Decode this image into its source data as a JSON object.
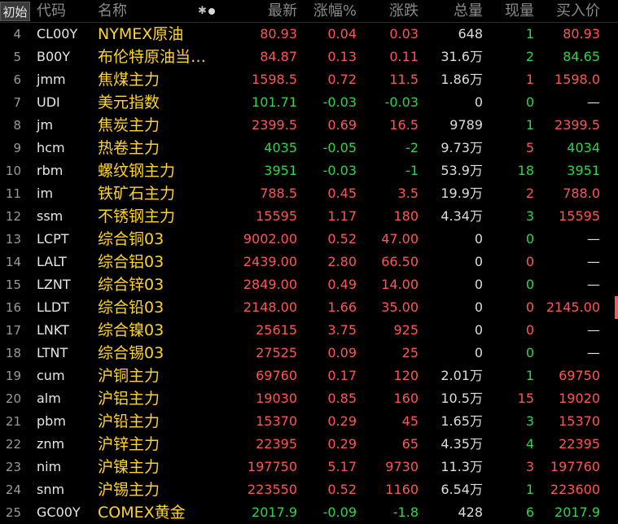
{
  "header": {
    "init_label": "初始",
    "cols": [
      "代码",
      "名称",
      "最新",
      "涨幅%",
      "涨跌",
      "总量",
      "现量",
      "买入价"
    ],
    "star_glyph": "✱"
  },
  "rows": [
    {
      "idx": "4",
      "code": "CL00Y",
      "name": "NYMEX原油",
      "last": "80.93",
      "pct": "0.04",
      "chg": "0.03",
      "vol": "648",
      "cur": "1",
      "bid": "80.93",
      "dir": "up",
      "bid_dir": "up"
    },
    {
      "idx": "5",
      "code": "B00Y",
      "name": "布伦特原油当…",
      "last": "84.87",
      "pct": "0.13",
      "chg": "0.11",
      "vol": "31.6万",
      "cur": "2",
      "bid": "84.65",
      "dir": "up",
      "bid_dir": "down"
    },
    {
      "idx": "6",
      "code": "jmm",
      "name": "焦煤主力",
      "last": "1598.5",
      "pct": "0.72",
      "chg": "11.5",
      "vol": "1.86万",
      "cur": "1",
      "bid": "1598.0",
      "dir": "up",
      "bid_dir": "up",
      "cur_dir": "up"
    },
    {
      "idx": "7",
      "code": "UDI",
      "name": "美元指数",
      "last": "101.71",
      "pct": "-0.03",
      "chg": "-0.03",
      "vol": "0",
      "cur": "0",
      "bid": "—",
      "dir": "down",
      "bid_dir": "flat"
    },
    {
      "idx": "8",
      "code": "jm",
      "name": "焦炭主力",
      "last": "2399.5",
      "pct": "0.69",
      "chg": "16.5",
      "vol": "9789",
      "cur": "1",
      "bid": "2399.5",
      "dir": "up",
      "bid_dir": "up"
    },
    {
      "idx": "9",
      "code": "hcm",
      "name": "热卷主力",
      "last": "4035",
      "pct": "-0.05",
      "chg": "-2",
      "vol": "9.73万",
      "cur": "5",
      "bid": "4034",
      "dir": "down",
      "bid_dir": "down",
      "cur_dir": "up"
    },
    {
      "idx": "10",
      "code": "rbm",
      "name": "螺纹钢主力",
      "last": "3951",
      "pct": "-0.03",
      "chg": "-1",
      "vol": "53.9万",
      "cur": "18",
      "bid": "3951",
      "dir": "down",
      "bid_dir": "down"
    },
    {
      "idx": "11",
      "code": "im",
      "name": "铁矿石主力",
      "last": "788.5",
      "pct": "0.45",
      "chg": "3.5",
      "vol": "19.9万",
      "cur": "2",
      "bid": "788.0",
      "dir": "up",
      "bid_dir": "up",
      "cur_dir": "up"
    },
    {
      "idx": "12",
      "code": "ssm",
      "name": "不锈钢主力",
      "last": "15595",
      "pct": "1.17",
      "chg": "180",
      "vol": "4.34万",
      "cur": "3",
      "bid": "15595",
      "dir": "up",
      "bid_dir": "up"
    },
    {
      "idx": "13",
      "code": "LCPT",
      "name": "综合铜03",
      "last": "9002.00",
      "pct": "0.52",
      "chg": "47.00",
      "vol": "0",
      "cur": "0",
      "bid": "—",
      "dir": "up",
      "bid_dir": "flat"
    },
    {
      "idx": "14",
      "code": "LALT",
      "name": "综合铝03",
      "last": "2439.00",
      "pct": "2.80",
      "chg": "66.50",
      "vol": "0",
      "cur": "0",
      "bid": "—",
      "dir": "up",
      "bid_dir": "flat",
      "cur_dir": "up"
    },
    {
      "idx": "15",
      "code": "LZNT",
      "name": "综合锌03",
      "last": "2849.00",
      "pct": "0.49",
      "chg": "14.00",
      "vol": "0",
      "cur": "0",
      "bid": "—",
      "dir": "up",
      "bid_dir": "flat"
    },
    {
      "idx": "16",
      "code": "LLDT",
      "name": "综合铅03",
      "last": "2148.00",
      "pct": "1.66",
      "chg": "35.00",
      "vol": "0",
      "cur": "0",
      "bid": "2145.00",
      "dir": "up",
      "bid_dir": "up",
      "cur_dir": "up"
    },
    {
      "idx": "17",
      "code": "LNKT",
      "name": "综合镍03",
      "last": "25615",
      "pct": "3.75",
      "chg": "925",
      "vol": "0",
      "cur": "0",
      "bid": "—",
      "dir": "up",
      "bid_dir": "flat",
      "cur_dir": "up"
    },
    {
      "idx": "18",
      "code": "LTNT",
      "name": "综合锡03",
      "last": "27525",
      "pct": "0.09",
      "chg": "25",
      "vol": "0",
      "cur": "0",
      "bid": "—",
      "dir": "up",
      "bid_dir": "flat"
    },
    {
      "idx": "19",
      "code": "cum",
      "name": "沪铜主力",
      "last": "69760",
      "pct": "0.17",
      "chg": "120",
      "vol": "2.01万",
      "cur": "1",
      "bid": "69750",
      "dir": "up",
      "bid_dir": "up"
    },
    {
      "idx": "20",
      "code": "alm",
      "name": "沪铝主力",
      "last": "19030",
      "pct": "0.85",
      "chg": "160",
      "vol": "10.5万",
      "cur": "15",
      "bid": "19020",
      "dir": "up",
      "bid_dir": "up",
      "cur_dir": "up"
    },
    {
      "idx": "21",
      "code": "pbm",
      "name": "沪铅主力",
      "last": "15370",
      "pct": "0.29",
      "chg": "45",
      "vol": "1.65万",
      "cur": "3",
      "bid": "15370",
      "dir": "up",
      "bid_dir": "up"
    },
    {
      "idx": "22",
      "code": "znm",
      "name": "沪锌主力",
      "last": "22395",
      "pct": "0.29",
      "chg": "65",
      "vol": "4.35万",
      "cur": "4",
      "bid": "22395",
      "dir": "up",
      "bid_dir": "up"
    },
    {
      "idx": "23",
      "code": "nim",
      "name": "沪镍主力",
      "last": "197750",
      "pct": "5.17",
      "chg": "9730",
      "vol": "11.3万",
      "cur": "3",
      "bid": "197760",
      "dir": "up",
      "bid_dir": "up",
      "cur_dir": "up"
    },
    {
      "idx": "24",
      "code": "snm",
      "name": "沪锡主力",
      "last": "223550",
      "pct": "0.52",
      "chg": "1160",
      "vol": "6.54万",
      "cur": "1",
      "bid": "223600",
      "dir": "up",
      "bid_dir": "up"
    },
    {
      "idx": "25",
      "code": "GC00Y",
      "name": "COMEX黄金",
      "last": "2017.9",
      "pct": "-0.09",
      "chg": "-1.8",
      "vol": "428",
      "cur": "6",
      "bid": "2017.9",
      "dir": "down",
      "bid_dir": "down"
    }
  ],
  "colors": {
    "up": "#ff5555",
    "down": "#2fd44a",
    "name": "#ffd42a",
    "bg": "#000000"
  }
}
